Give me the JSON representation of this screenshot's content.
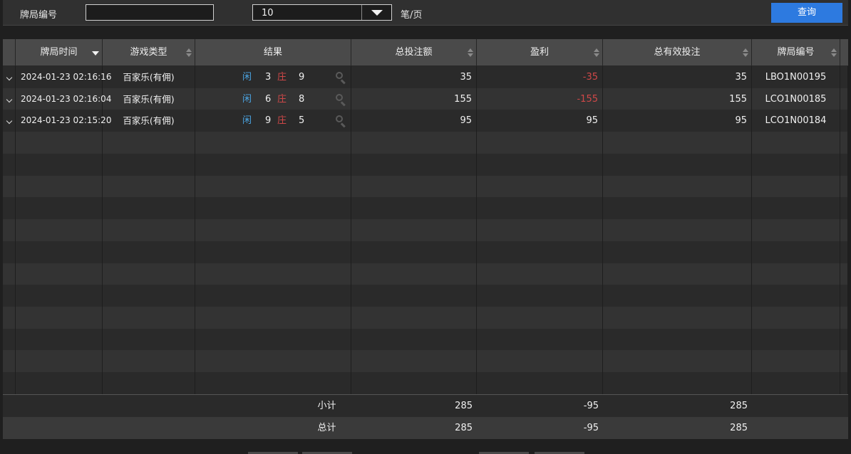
{
  "filter": {
    "game_id_label": "牌局编号",
    "game_id_value": "",
    "page_size_value": "10",
    "page_size_unit": "笔/页",
    "query_button": "查询"
  },
  "columns": {
    "time": "牌局时间",
    "game_type": "游戏类型",
    "result": "结果",
    "total_bet": "总投注额",
    "profit": "盈利",
    "valid_bet": "总有效投注",
    "game_id": "牌局编号"
  },
  "rows": [
    {
      "time": "2024-01-23 02:16:16",
      "game_type": "百家乐(有佣)",
      "player_label": "闲",
      "player_value": "3",
      "banker_label": "庄",
      "banker_value": "9",
      "total_bet": "35",
      "profit": "-35",
      "profit_negative": true,
      "valid_bet": "35",
      "game_id": "LBO1N00195"
    },
    {
      "time": "2024-01-23 02:16:04",
      "game_type": "百家乐(有佣)",
      "player_label": "闲",
      "player_value": "6",
      "banker_label": "庄",
      "banker_value": "8",
      "total_bet": "155",
      "profit": "-155",
      "profit_negative": true,
      "valid_bet": "155",
      "game_id": "LCO1N00185"
    },
    {
      "time": "2024-01-23 02:15:20",
      "game_type": "百家乐(有佣)",
      "player_label": "闲",
      "player_value": "9",
      "banker_label": "庄",
      "banker_value": "5",
      "total_bet": "95",
      "profit": "95",
      "profit_negative": false,
      "valid_bet": "95",
      "game_id": "LCO1N00184"
    }
  ],
  "summary": {
    "subtotal_label": "小计",
    "subtotal_bet": "285",
    "subtotal_profit": "-95",
    "subtotal_valid": "285",
    "total_label": "总计",
    "total_bet": "285",
    "total_profit": "-95",
    "total_valid": "285"
  },
  "colors": {
    "accent": "#2d7ae0",
    "negative": "#d04848",
    "player": "#4aa3e0"
  },
  "icons": {
    "row_expand": "chevron-down-icon",
    "result_detail": "search-icon",
    "sort": "sort-icon",
    "select_arrow": "caret-down-icon"
  }
}
